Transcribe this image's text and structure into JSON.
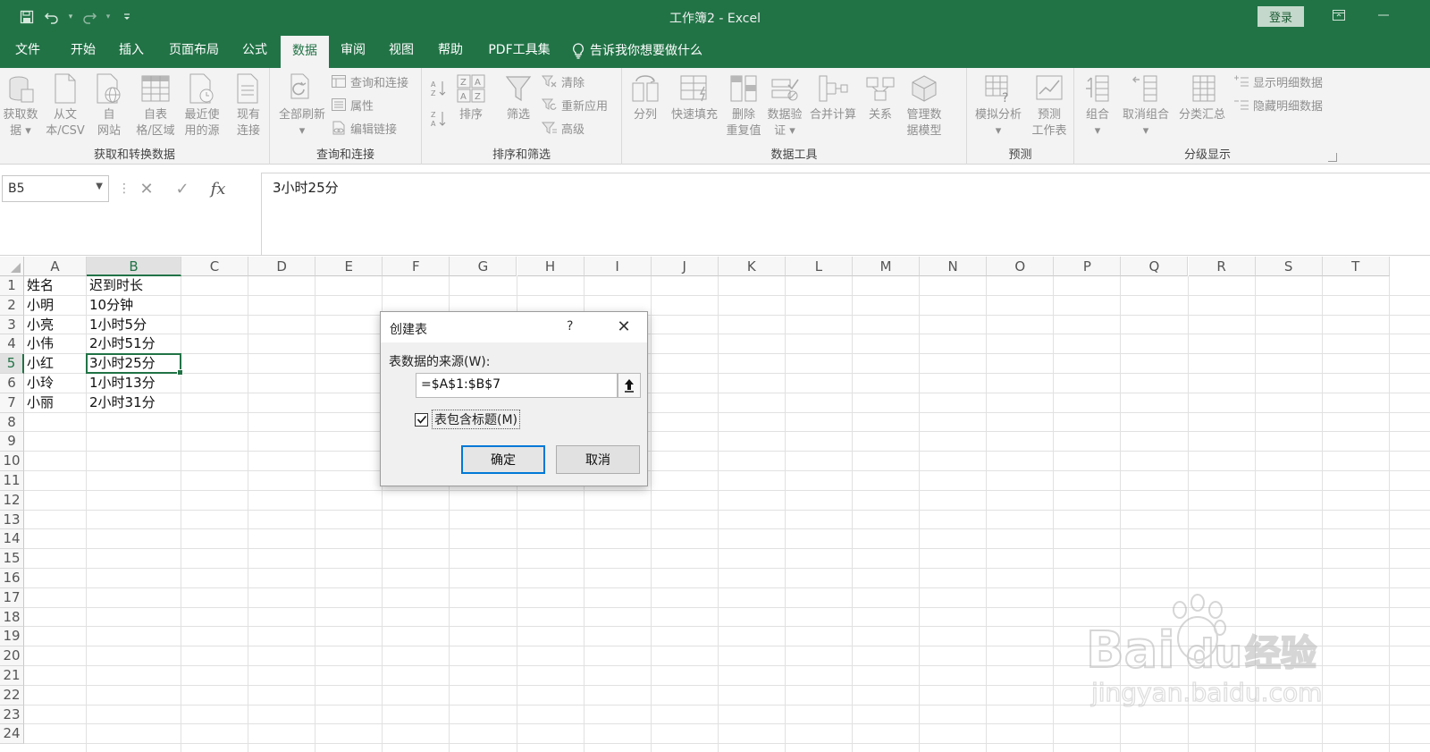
{
  "title_bar": {
    "title": "工作簿2  -  Excel",
    "login_label": "登录",
    "qat_icons": [
      "save-icon",
      "undo-icon",
      "redo-icon",
      "customize-icon"
    ]
  },
  "tabs": [
    {
      "label": "文件"
    },
    {
      "label": "开始"
    },
    {
      "label": "插入"
    },
    {
      "label": "页面布局"
    },
    {
      "label": "公式"
    },
    {
      "label": "数据",
      "active": true
    },
    {
      "label": "审阅"
    },
    {
      "label": "视图"
    },
    {
      "label": "帮助"
    },
    {
      "label": "PDF工具集"
    }
  ],
  "tell_me": "告诉我你想要做什么",
  "ribbon": {
    "get_transform": {
      "label": "获取和转换数据",
      "buttons": [
        {
          "l1": "获取数",
          "l2": "据 ▾"
        },
        {
          "l1": "从文",
          "l2": "本/CSV"
        },
        {
          "l1": "自",
          "l2": "网站"
        },
        {
          "l1": "自表",
          "l2": "格/区域"
        },
        {
          "l1": "最近使",
          "l2": "用的源"
        },
        {
          "l1": "现有",
          "l2": "连接"
        }
      ]
    },
    "query_conn": {
      "label": "查询和连接",
      "refresh": {
        "l1": "全部刷新",
        "l2": "▾"
      },
      "small": [
        "查询和连接",
        "属性",
        "编辑链接"
      ]
    },
    "sort_filter": {
      "label": "排序和筛选",
      "sort": "排序",
      "filter": "筛选",
      "small": [
        "清除",
        "重新应用",
        "高级"
      ]
    },
    "data_tools": {
      "label": "数据工具",
      "buttons": [
        {
          "l1": "分列",
          "l2": ""
        },
        {
          "l1": "快速填充",
          "l2": ""
        },
        {
          "l1": "删除",
          "l2": "重复值"
        },
        {
          "l1": "数据验",
          "l2": "证 ▾"
        },
        {
          "l1": "合并计算",
          "l2": ""
        },
        {
          "l1": "关系",
          "l2": ""
        },
        {
          "l1": "管理数",
          "l2": "据模型"
        }
      ]
    },
    "forecast": {
      "label": "预测",
      "buttons": [
        {
          "l1": "模拟分析",
          "l2": "▾"
        },
        {
          "l1": "预测",
          "l2": "工作表"
        }
      ]
    },
    "outline": {
      "label": "分级显示",
      "buttons": [
        {
          "l1": "组合",
          "l2": "▾"
        },
        {
          "l1": "取消组合",
          "l2": "▾"
        },
        {
          "l1": "分类汇总",
          "l2": ""
        }
      ],
      "small": [
        "显示明细数据",
        "隐藏明细数据"
      ]
    }
  },
  "formula_bar": {
    "name_box": "B5",
    "fx": "fx",
    "content": "3小时25分"
  },
  "sheet": {
    "columns": [
      "A",
      "B",
      "C",
      "D",
      "E",
      "F",
      "G",
      "H",
      "I",
      "J",
      "K",
      "L",
      "M",
      "N",
      "O",
      "P",
      "Q",
      "R",
      "S",
      "T"
    ],
    "rows": [
      "1",
      "2",
      "3",
      "4",
      "5",
      "6",
      "7",
      "8",
      "9",
      "10",
      "11",
      "12",
      "13",
      "14",
      "15",
      "16",
      "17",
      "18",
      "19",
      "20",
      "21",
      "22",
      "23",
      "24"
    ],
    "selected_column": "B",
    "selected_row": "5",
    "cells": [
      [
        "姓名",
        "迟到时长"
      ],
      [
        "小明",
        "10分钟"
      ],
      [
        "小亮",
        "1小时5分"
      ],
      [
        "小伟",
        "2小时51分"
      ],
      [
        "小红",
        "3小时25分"
      ],
      [
        "小玲",
        "1小时13分"
      ],
      [
        "小丽",
        "2小时31分"
      ]
    ]
  },
  "dialog": {
    "title": "创建表",
    "help": "?",
    "source_label": "表数据的来源(W):",
    "range": "=$A$1:$B$7",
    "has_headers_label": "表包含标题(M)",
    "has_headers_checked": true,
    "ok_label": "确定",
    "cancel_label": "取消"
  },
  "watermark": {
    "brand": "Bai du 经验",
    "url": "jingyan.baidu.com"
  }
}
